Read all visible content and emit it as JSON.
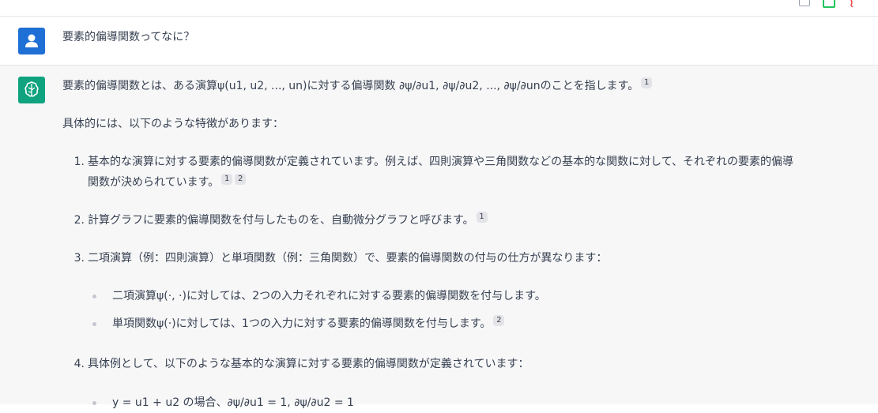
{
  "user": {
    "question": "要素的偏導関数ってなに？"
  },
  "assistant": {
    "intro": "要素的偏導関数とは、ある演算ψ(u1, u2, ..., un)に対する偏導関数 ∂ψ/∂u1, ∂ψ/∂u2, ..., ∂ψ/∂unのことを指します。",
    "intro_cites": [
      "1"
    ],
    "features_lead": "具体的には、以下のような特徴があります：",
    "items": [
      {
        "number": "1.",
        "line1": "基本的な演算に対する要素的偏導関数が定義されています。例えば、四則演算や三角関数などの基本的な関数に対して、それぞれの要素的偏導",
        "line2": "関数が決められています。",
        "cites": [
          "1",
          "2"
        ]
      },
      {
        "number": "2.",
        "text": "計算グラフに要素的偏導関数を付与したものを、自動微分グラフと呼びます。",
        "cites": [
          "1"
        ]
      },
      {
        "number": "3.",
        "text": "二項演算（例：四則演算）と単項関数（例：三角関数）で、要素的偏導関数の付与の仕方が異なります：",
        "subitems": [
          {
            "text": "二項演算ψ(·, ·)に対しては、2つの入力それぞれに対する要素的偏導関数を付与します。"
          },
          {
            "text": "単項関数ψ(·)に対しては、1つの入力に対する要素的偏導関数を付与します。",
            "cite": "2"
          }
        ]
      },
      {
        "number": "4.",
        "text": "具体例として、以下のような基本的な演算に対する要素的偏導関数が定義されています：",
        "subitems": [
          {
            "text": "y = u1 + u2 の場合、∂ψ/∂u1 = 1, ∂ψ/∂u2 = 1"
          }
        ]
      }
    ]
  },
  "icons": {
    "user_avatar": "user-icon",
    "assistant_avatar": "brain-icon",
    "top_actions": [
      "copy-icon",
      "thumbs-up-icon",
      "thumbs-down-icon"
    ]
  },
  "colors": {
    "user_avatar_bg": "#1e6fd6",
    "assistant_avatar_bg": "#10a37f",
    "assistant_bg": "#f7f7f8"
  }
}
